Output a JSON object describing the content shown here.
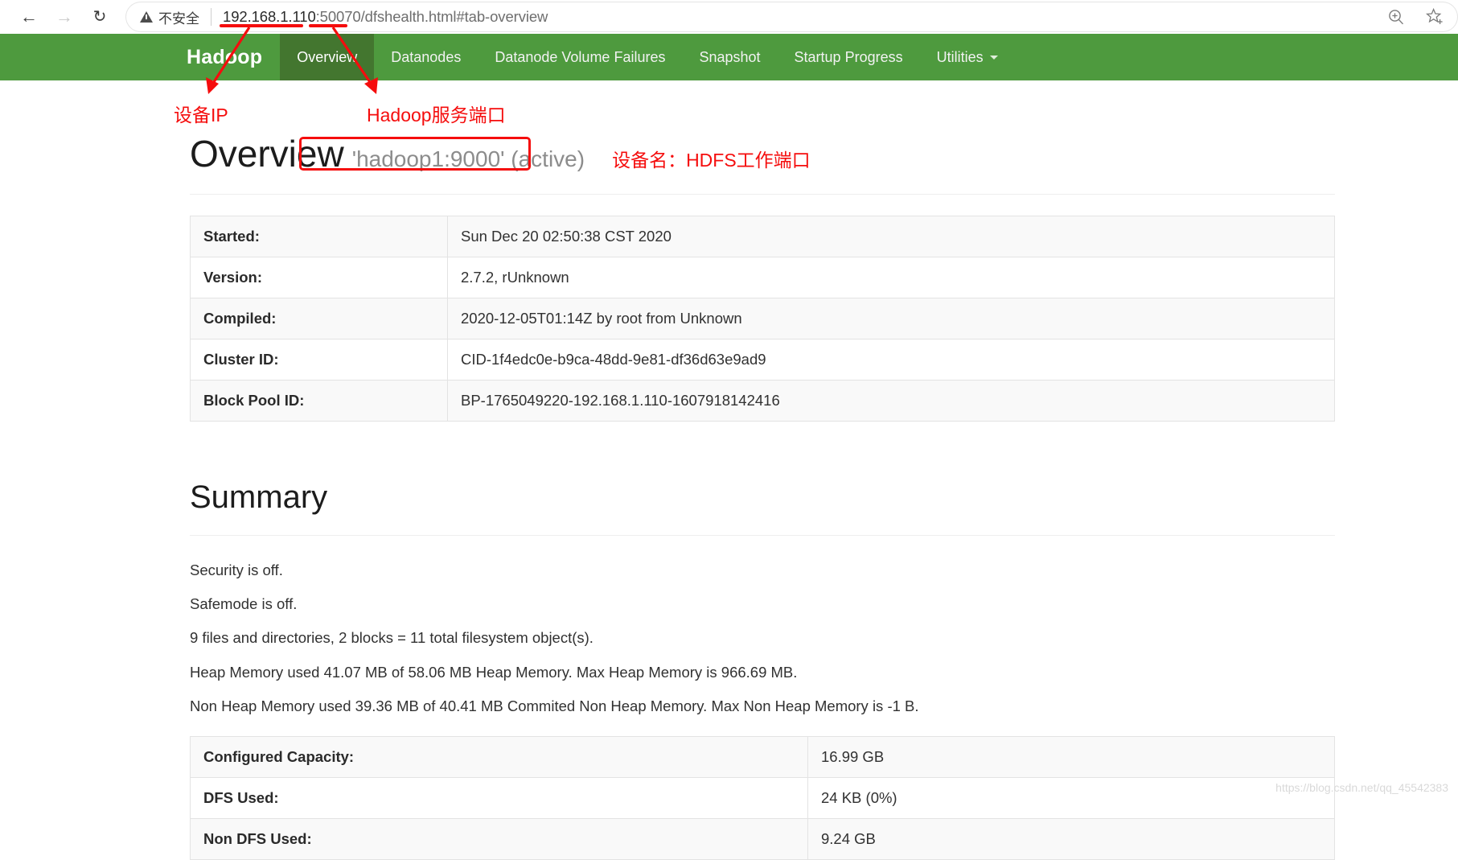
{
  "browser": {
    "back_icon": "arrow-left-icon",
    "forward_icon": "arrow-right-icon",
    "reload_icon": "reload-icon",
    "security_label": "不安全",
    "url_host": "192.168.1.110",
    "url_port": ":50070",
    "url_path": "/dfshealth.html#tab-overview",
    "zoom_icon": "zoom-in-icon",
    "bookmark_icon": "star-add-icon"
  },
  "navbar": {
    "brand": "Hadoop",
    "items": [
      {
        "label": "Overview",
        "active": true
      },
      {
        "label": "Datanodes",
        "active": false
      },
      {
        "label": "Datanode Volume Failures",
        "active": false
      },
      {
        "label": "Snapshot",
        "active": false
      },
      {
        "label": "Startup Progress",
        "active": false
      },
      {
        "label": "Utilities",
        "active": false,
        "has_caret": true
      }
    ]
  },
  "annotations": {
    "device_ip": "设备IP",
    "hadoop_service_port": "Hadoop服务端口",
    "device_name_note": "设备名：HDFS工作端口",
    "accent_color": "#f50d0d"
  },
  "overview": {
    "title": "Overview",
    "ha_state": "'hadoop1:9000' (active)",
    "rows": [
      {
        "key": "Started:",
        "value": "Sun Dec 20 02:50:38 CST 2020"
      },
      {
        "key": "Version:",
        "value": "2.7.2, rUnknown"
      },
      {
        "key": "Compiled:",
        "value": "2020-12-05T01:14Z by root from Unknown"
      },
      {
        "key": "Cluster ID:",
        "value": "CID-1f4edc0e-b9ca-48dd-9e81-df36d63e9ad9"
      },
      {
        "key": "Block Pool ID:",
        "value": "BP-1765049220-192.168.1.110-1607918142416"
      }
    ]
  },
  "summary": {
    "title": "Summary",
    "lines": [
      "Security is off.",
      "Safemode is off.",
      "9 files and directories, 2 blocks = 11 total filesystem object(s).",
      "Heap Memory used 41.07 MB of 58.06 MB Heap Memory. Max Heap Memory is 966.69 MB.",
      "Non Heap Memory used 39.36 MB of 40.41 MB Commited Non Heap Memory. Max Non Heap Memory is -1 B."
    ],
    "rows": [
      {
        "key": "Configured Capacity:",
        "value": "16.99 GB"
      },
      {
        "key": "DFS Used:",
        "value": "24 KB (0%)"
      },
      {
        "key": "Non DFS Used:",
        "value": "9.24 GB"
      }
    ]
  },
  "watermark": "https://blog.csdn.net/qq_45542383"
}
